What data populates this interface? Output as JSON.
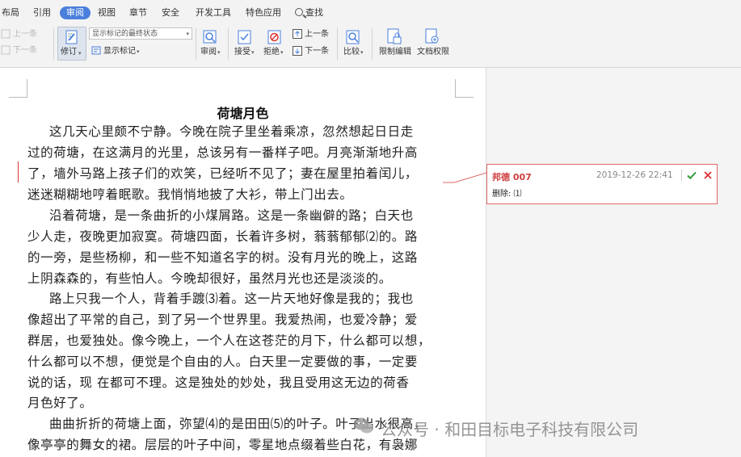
{
  "ribbon": {
    "tabs": [
      {
        "label": "布局",
        "name": "tab-layout"
      },
      {
        "label": "引用",
        "name": "tab-references"
      },
      {
        "label": "审阅",
        "name": "tab-review",
        "active": true
      },
      {
        "label": "视图",
        "name": "tab-view"
      },
      {
        "label": "章节",
        "name": "tab-sections"
      },
      {
        "label": "安全",
        "name": "tab-security"
      },
      {
        "label": "开发工具",
        "name": "tab-developer"
      },
      {
        "label": "特色应用",
        "name": "tab-features"
      },
      {
        "label": "查找",
        "name": "tab-find"
      }
    ],
    "prev_comment": "上一条",
    "next_comment": "下一条",
    "track_changes": "修订",
    "markup_mode": "显示标记的最终状态",
    "show_markup": "显示标记",
    "review_pane": "审阅",
    "accept": "接受",
    "reject": "拒绝",
    "prev_change": "上一条",
    "next_change": "下一条",
    "compare": "比较",
    "restrict_editing": "限制编辑",
    "doc_permissions": "文档权限",
    "accent_color": "#4a7fdc"
  },
  "document": {
    "title": "荷塘月色",
    "lines": [
      "这几天心里颇不宁静。今晚在院子里坐着乘凉，忽然想起日日走",
      "过的荷塘，在这满月的光里，总该另有一番样子吧。月亮渐渐地升高",
      "了，墙外马路上孩子们的欢笑，已经听不见了；妻在屋里拍着闰儿，",
      "迷迷糊糊地哼着眠歌。我悄悄地披了大衫，带上门出去。",
      "沿着荷塘，是一条曲折的小煤屑路。这是一条幽僻的路；白天也",
      "少人走，夜晚更加寂寞。荷塘四面，长着许多树，蓊蓊郁郁⑵的。路",
      "的一旁，是些杨柳，和一些不知道名字的树。没有月光的晚上，这路",
      "上阴森森的，有些怕人。今晚却很好，虽然月光也还是淡淡的。",
      "路上只我一个人，背着手踱⑶着。这一片天地好像是我的；我也",
      "像超出了平常的自己，到了另一个世界里。我爱热闹，也爱冷静；爱",
      "群居，也爱独处。像今晚上，一个人在这苍茫的月下，什么都可以想，",
      "什么都可以不想，便觉是个自由的人。白天里一定要做的事，一定要",
      "说的话，现 在都可不理。这是独处的妙处，我且受用这无边的荷香",
      "月色好了。",
      "曲曲折折的荷塘上面，弥望⑷的是田田⑸的叶子。叶子出水很高，",
      "像亭亭的舞女的裙。层层的叶子中间，零星地点缀着些白花，有袅娜"
    ]
  },
  "comment": {
    "author": "邦德 007",
    "time": "2019-12-26 22:41",
    "body": "删除: ⑴",
    "color": "#d04040"
  },
  "watermark": {
    "text": "公众号 · 和田目标电子科技有限公司"
  }
}
